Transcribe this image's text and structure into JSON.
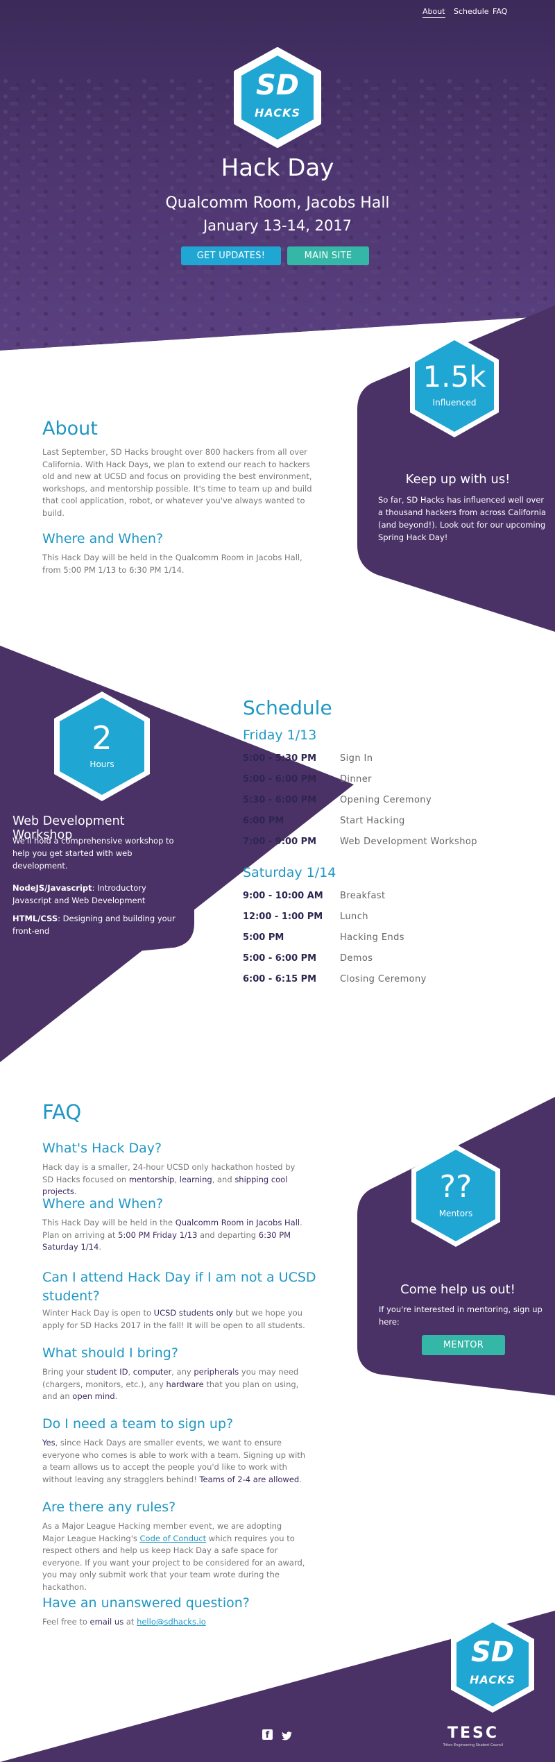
{
  "nav": {
    "items": [
      "About",
      "Schedule",
      "FAQ"
    ],
    "active": "About"
  },
  "hero": {
    "logo_text_top": "SD",
    "logo_text_bottom": "HACKS",
    "title": "Hack Day",
    "location": "Qualcomm Room, Jacobs Hall",
    "dates": "January 13-14, 2017",
    "btn_updates": "GET UPDATES!",
    "btn_main": "MAIN SITE"
  },
  "about": {
    "heading": "About",
    "body": "Last September, SD Hacks brought over 800 hackers from all over California. With Hack Days, we plan to extend our reach to hackers old and new at UCSD and focus on providing the best environment, workshops, and mentorship possible. It's time to team up and build that cool application, robot, or whatever you've always wanted to build.",
    "where_heading": "Where and When?",
    "where_body": "This Hack Day will be held in the Qualcomm Room in Jacobs Hall, from 5:00 PM 1/13 to 6:30 PM 1/14."
  },
  "influence": {
    "number": "1.5k",
    "label": "Influenced",
    "heading": "Keep up with us!",
    "body": "So far, SD Hacks has influenced well over a thousand hackers from across California (and beyond!). Look out for our upcoming Spring Hack Day!"
  },
  "workshop": {
    "number": "2",
    "label": "Hours",
    "heading": "Web Development Workshop",
    "body": "We'll hold a comprehensive workshop to help you get started with web development.",
    "item1_bold": "NodeJS/Javascript",
    "item1_rest": ": Introductory Javascript and Web Development",
    "item2_bold": "HTML/CSS",
    "item2_rest": ": Designing and building your front-end"
  },
  "schedule": {
    "heading": "Schedule",
    "days": [
      {
        "name": "Friday 1/13",
        "events": [
          {
            "time": "5:00 - 5:30 PM",
            "event": "Sign In"
          },
          {
            "time": "5:00 - 6:00 PM",
            "event": "Dinner"
          },
          {
            "time": "5:30 - 6:00 PM",
            "event": "Opening Ceremony"
          },
          {
            "time": "6:00 PM",
            "event": "Start Hacking"
          },
          {
            "time": "7:00 - 9:00 PM",
            "event": "Web Development Workshop"
          }
        ]
      },
      {
        "name": "Saturday 1/14",
        "events": [
          {
            "time": "9:00 - 10:00 AM",
            "event": "Breakfast"
          },
          {
            "time": "12:00 - 1:00 PM",
            "event": "Lunch"
          },
          {
            "time": "5:00 PM",
            "event": "Hacking Ends"
          },
          {
            "time": "5:00 - 6:00 PM",
            "event": "Demos"
          },
          {
            "time": "6:00 - 6:15 PM",
            "event": "Closing Ceremony"
          }
        ]
      }
    ]
  },
  "faq": {
    "heading": "FAQ",
    "q1": "What's Hack Day?",
    "a1": [
      "Hack day is a smaller, 24-hour UCSD only hackathon hosted by SD Hacks focused on ",
      "mentorship",
      ", ",
      "learning",
      ", and ",
      "shipping cool projects",
      "."
    ],
    "q2": "Where and When?",
    "a2": [
      "This Hack Day will be held in the ",
      "Qualcomm Room in Jacobs Hall",
      ". Plan on arriving at ",
      "5:00 PM Friday 1/13",
      " and departing ",
      "6:30 PM Saturday 1/14",
      "."
    ],
    "q3": "Can I attend Hack Day if I am not a UCSD student?",
    "a3": [
      "Winter Hack Day is open to ",
      "UCSD students only",
      " but we hope you apply for SD Hacks 2017 in the fall! It will be open to all students."
    ],
    "q4": "What should I bring?",
    "a4": [
      "Bring your ",
      "student ID",
      ", ",
      "computer",
      ", any ",
      "peripherals",
      " you may need (chargers, monitors, etc.), any ",
      "hardware",
      " that you plan on using, and an ",
      "open mind",
      "."
    ],
    "q5": "Do I need a team to sign up?",
    "a5": [
      "Yes",
      ", since Hack Days are smaller events, we want to ensure everyone who comes is able to work with a team. Signing up with a team allows us to accept the people you'd like to work with without leaving any stragglers behind! ",
      "Teams of 2-4 are allowed",
      "."
    ],
    "q6": "Are there any rules?",
    "a6_pre": "As a Major League Hacking member event, we are adopting Major League Hacking's ",
    "a6_link": "Code of Conduct",
    "a6_post": " which requires you to respect others and help us keep Hack Day a safe space for everyone. If you want your project to be considered for an award, you may only submit work that your team wrote during the hackathon.",
    "q7": "Have an unanswered question?",
    "a7_pre": "Feel free to ",
    "a7_bold": "email us",
    "a7_mid": " at ",
    "a7_link": "hello@sdhacks.io"
  },
  "mentors": {
    "number": "??",
    "label": "Mentors",
    "heading": "Come help us out!",
    "body": "If you're interested in mentoring, sign up here:",
    "button": "MENTOR"
  },
  "footer": {
    "logo_top": "SD",
    "logo_bottom": "HACKS",
    "tesc": "TESC",
    "tesc_sub": "Triton Engineering Student Council"
  },
  "colors": {
    "purple": "#4a3266",
    "blue": "#1fa6d3",
    "teal": "#34b7a6"
  }
}
